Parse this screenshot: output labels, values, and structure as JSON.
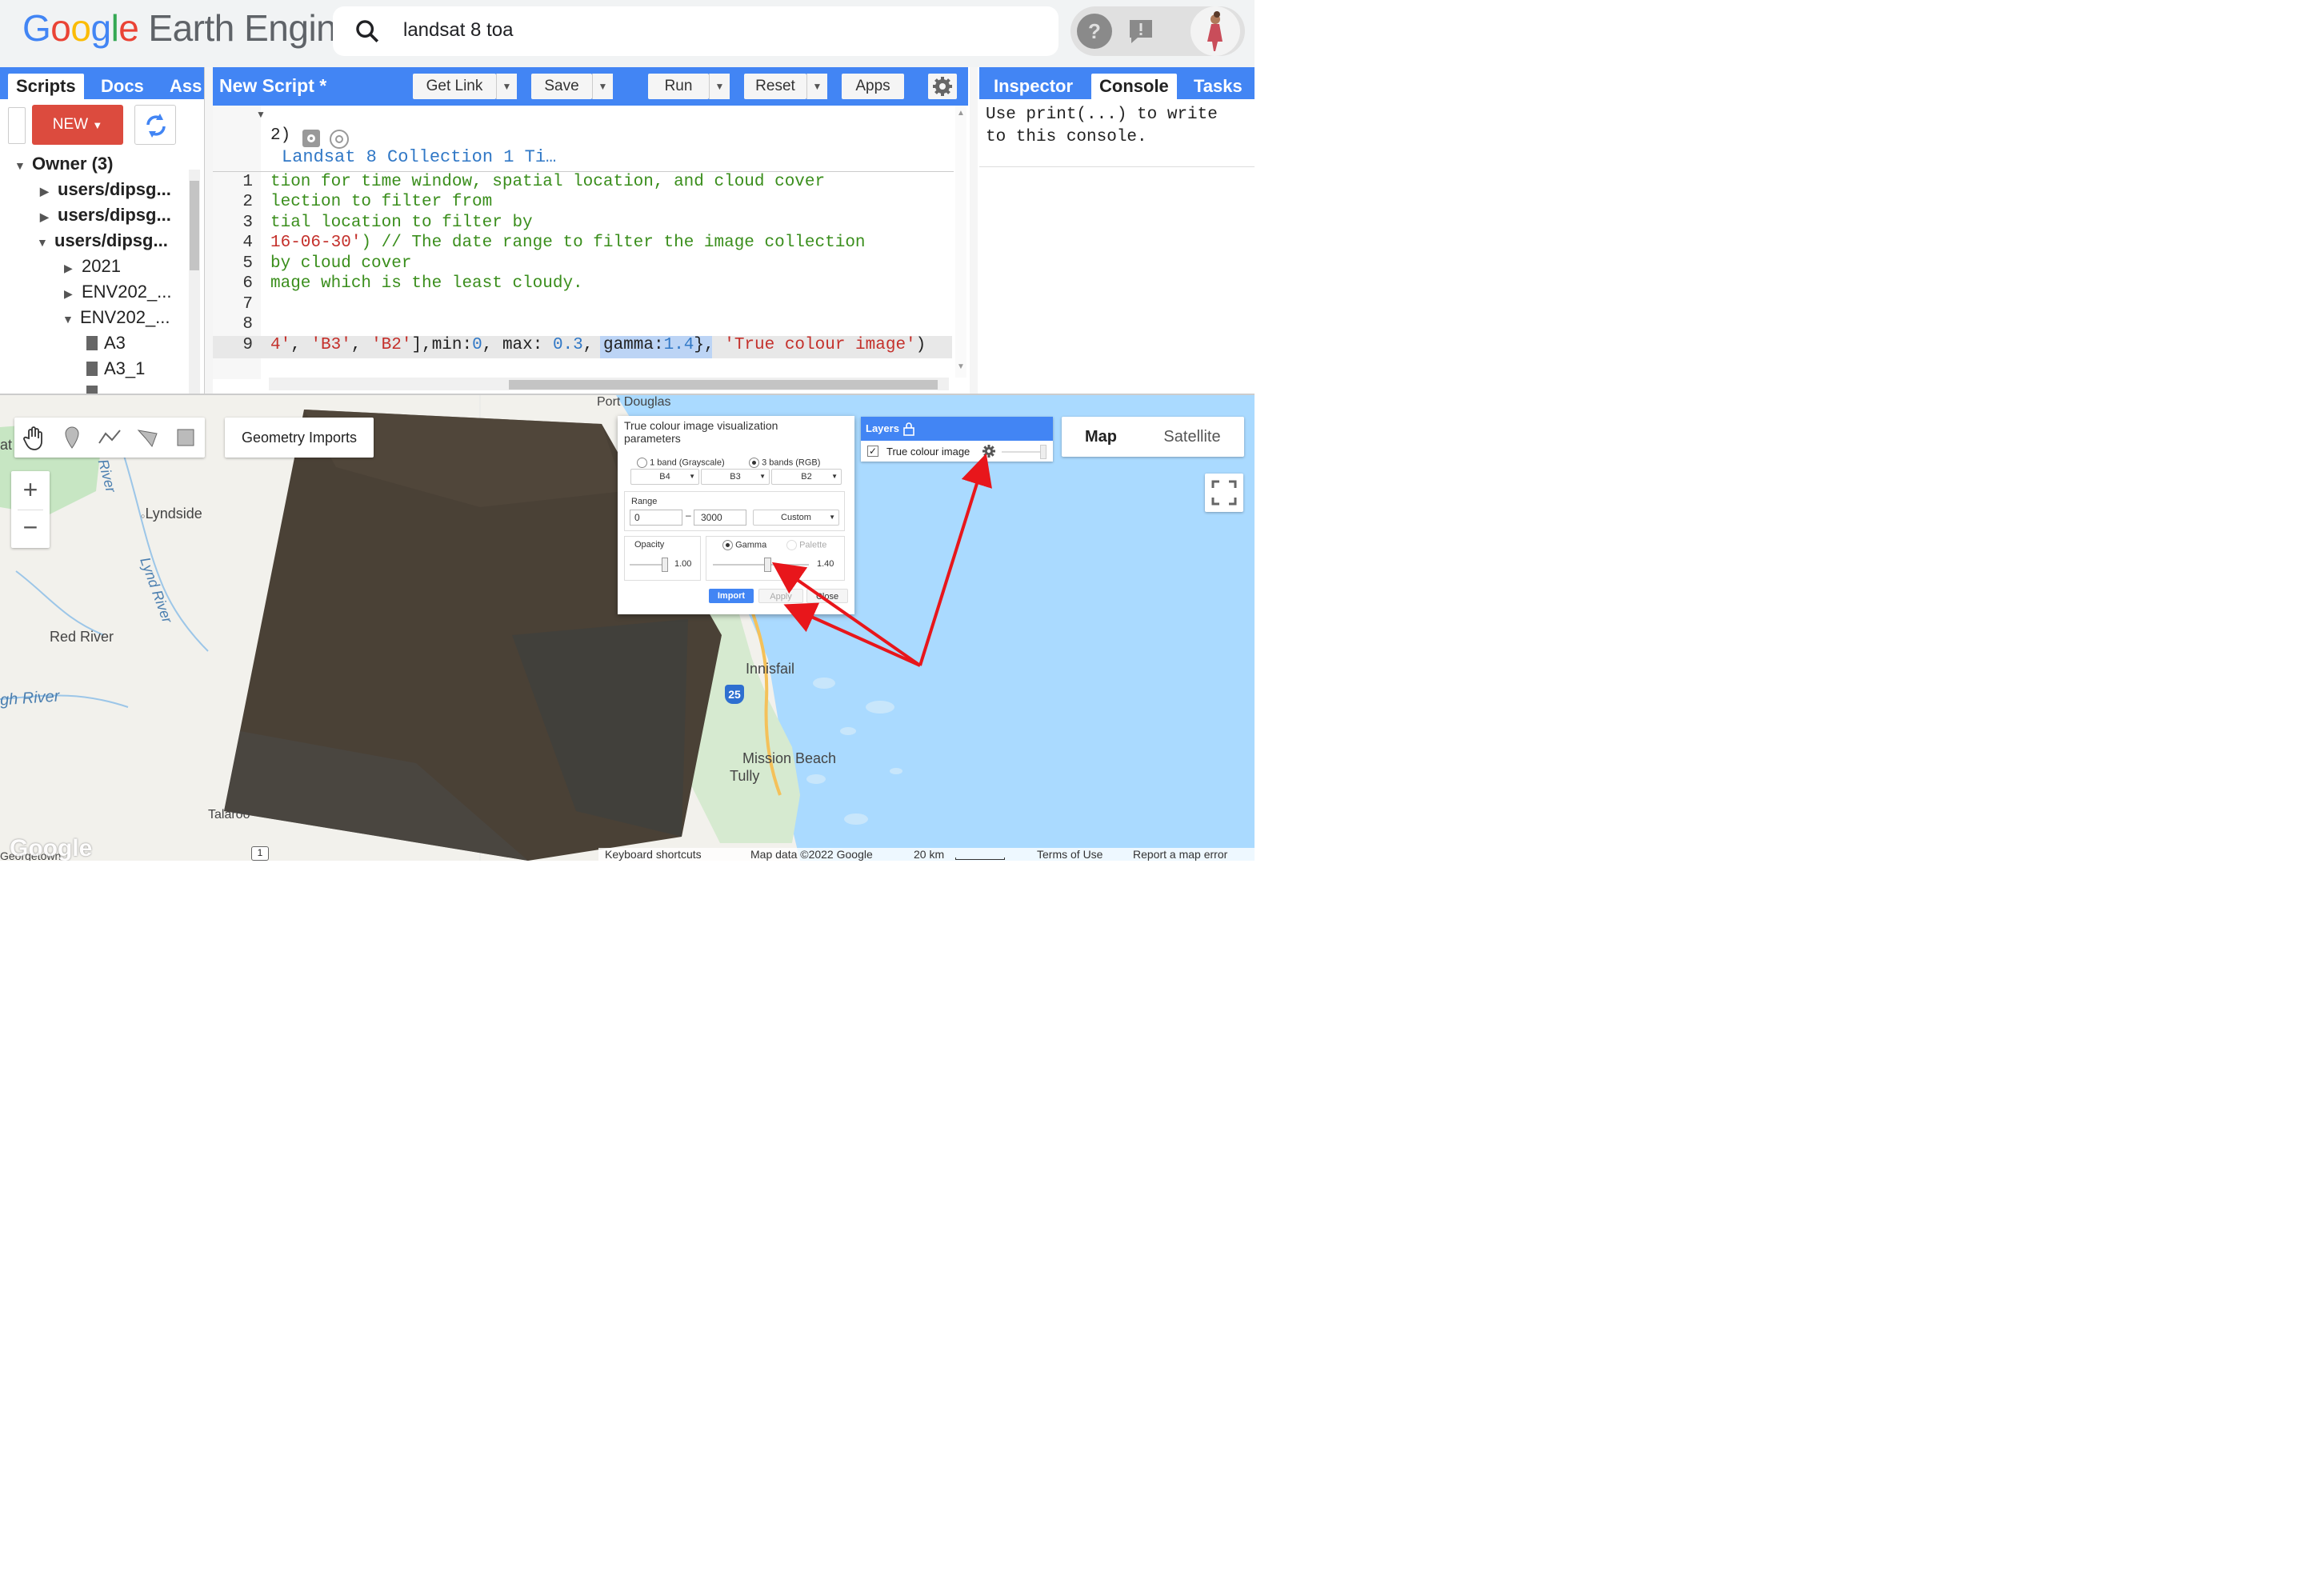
{
  "header": {
    "logo": {
      "google": "Google",
      "product": "Earth Engine"
    },
    "search": {
      "value": "landsat 8 toa"
    }
  },
  "left_panel": {
    "tabs": [
      "Scripts",
      "Docs",
      "Ass"
    ],
    "new_label": "NEW",
    "tree": [
      {
        "label": "Owner (3)",
        "bold": true
      },
      {
        "label": "users/dipsg...",
        "bold": true
      },
      {
        "label": "users/dipsg...",
        "bold": true
      },
      {
        "label": "users/dipsg...",
        "bold": true
      },
      {
        "label": "2021"
      },
      {
        "label": "ENV202_..."
      },
      {
        "label": "ENV202_..."
      },
      {
        "label": "A3"
      },
      {
        "label": "A3_1"
      }
    ]
  },
  "editor": {
    "title": "New Script *",
    "buttons": {
      "get_link": "Get Link",
      "save": "Save",
      "run": "Run",
      "reset": "Reset",
      "apps": "Apps"
    },
    "imports_line_prefix": "2)",
    "imports_line_text": "Landsat 8 Collection 1 Ti…",
    "line_numbers": [
      "1",
      "2",
      "3",
      "4",
      "5",
      "6",
      "7",
      "8",
      "9"
    ],
    "lines": {
      "l1": "tion for time window, spatial location, and cloud cover",
      "l2": "lection to filter from",
      "l3": "tial location to filter by",
      "l4a": "16-06-30'",
      "l4b": ") // The date range to filter the image collection",
      "l5": "by cloud cover",
      "l6": "mage which is the least cloudy.",
      "l9a": "4'",
      "l9b": ", ",
      "l9c": "'B3'",
      "l9d": ", ",
      "l9e": "'B2'",
      "l9f": "],min:",
      "l9g": "0",
      "l9h": ", max: ",
      "l9i": "0.3",
      "l9j": ", gamma:",
      "l9k": "1.4",
      "l9l": "}, ",
      "l9m": "'True colour image'",
      "l9n": ")"
    }
  },
  "right_panel": {
    "tabs": [
      "Inspector",
      "Console",
      "Tasks"
    ],
    "console_text": "Use print(...) to write\nto this console."
  },
  "map": {
    "geometry_imports": "Geometry Imports",
    "map_type": {
      "map": "Map",
      "satellite": "Satellite"
    },
    "labels": {
      "lyndside": "Lyndside",
      "river": "River",
      "lynd_river": "Lynd River",
      "red_river": "Red River",
      "gh_river": "gh River",
      "innisfail": "Innisfail",
      "mission_beach": "Mission Beach",
      "tully": "Tully",
      "talaroo": "Talaroo",
      "port_douglas": "Port Douglas",
      "georgetown": "Georgetown",
      "at": "at",
      "route_25": "25",
      "route_1": "1"
    },
    "layers_panel": {
      "title": "Layers",
      "layer_name": "True colour image"
    },
    "viz_panel": {
      "title": "True colour image visualization parameters",
      "band_mode_1": "1 band (Grayscale)",
      "band_mode_3": "3 bands (RGB)",
      "bands": [
        "B4",
        "B3",
        "B2"
      ],
      "range_label": "Range",
      "range_min": "0",
      "range_max": "3000",
      "range_dash": "–",
      "range_mode": "Custom",
      "opacity_label": "Opacity",
      "opacity_value": "1.00",
      "gamma_label": "Gamma",
      "palette_label": "Palette",
      "gamma_value": "1.40",
      "import_btn": "Import",
      "apply_btn": "Apply",
      "close_btn": "Close"
    },
    "attribution": {
      "shortcuts": "Keyboard shortcuts",
      "data": "Map data ©2022 Google",
      "scale": "20 km",
      "terms": "Terms of Use",
      "report": "Report a map error"
    },
    "google_mark": "Google"
  },
  "colors": {
    "accent": "#4285f4",
    "new_button": "#dc4b3e",
    "arrow": "#e8161b",
    "water": "#aadaff"
  }
}
